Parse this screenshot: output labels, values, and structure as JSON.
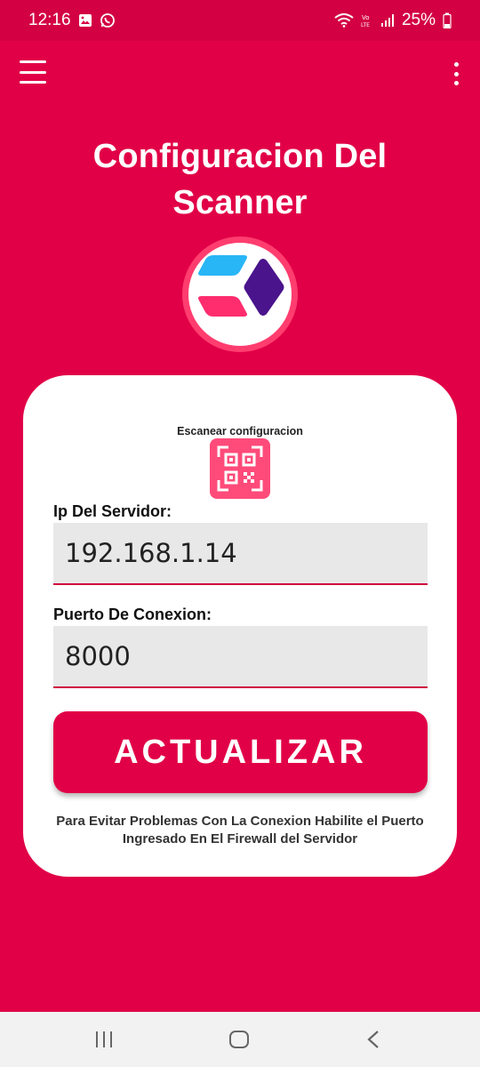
{
  "status_bar": {
    "time": "12:16",
    "battery": "25%",
    "icons": [
      "gallery-icon",
      "whatsapp-icon",
      "wifi-icon",
      "volte-icon",
      "signal-icon",
      "battery-icon"
    ]
  },
  "toolbar": {
    "menu_icon": "hamburger-menu-icon",
    "more_icon": "more-vert-icon"
  },
  "page": {
    "title_line1": "Configuracion Del",
    "title_line2": "Scanner"
  },
  "form": {
    "scan_label": "Escanear configuracion",
    "ip_label": "Ip Del Servidor:",
    "ip_value": "192.168.1.14",
    "port_label": "Puerto De Conexion:",
    "port_value": "8000",
    "button_label": "ACTUALIZAR",
    "help_line1": "Para Evitar Problemas Con La Conexion Habilite el Puerto",
    "help_line2": "Ingresado En El Firewall del Servidor"
  },
  "colors": {
    "primary": "#e10047",
    "status_bar": "#d30043",
    "logo_blue": "#29b6f6",
    "logo_purple": "#4a148c",
    "logo_pink": "#ff2d6e",
    "field_bg": "#e8e8e8"
  },
  "nav_bar": {
    "icons": [
      "recent-apps-icon",
      "home-icon",
      "back-icon"
    ]
  }
}
